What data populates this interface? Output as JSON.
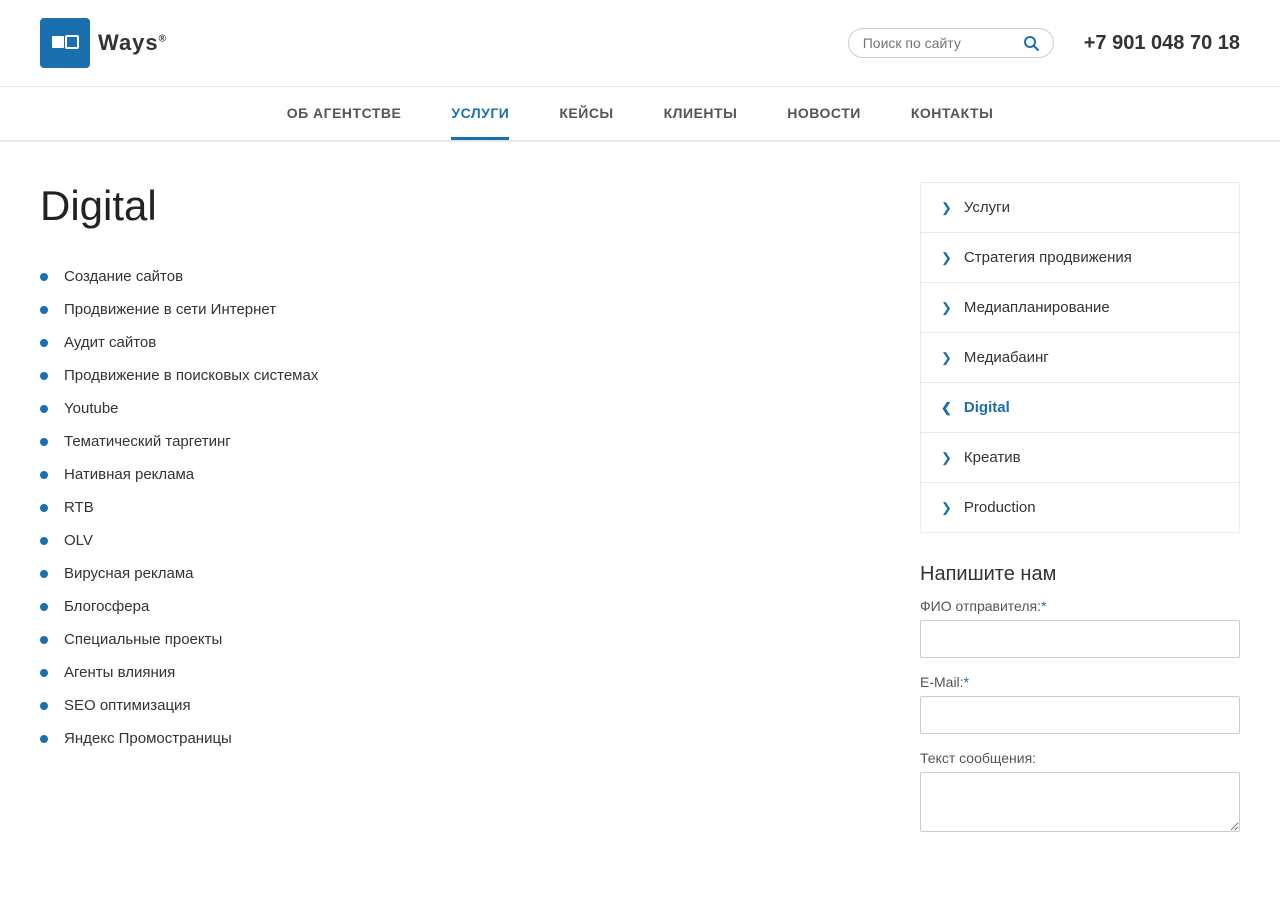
{
  "logo": {
    "text": "Ways",
    "sup": "®"
  },
  "header": {
    "search_placeholder": "Поиск по сайту",
    "phone": "+7 901 048 70 18"
  },
  "nav": {
    "items": [
      {
        "label": "ОБ АГЕНТСТВЕ",
        "active": false
      },
      {
        "label": "УСЛУГИ",
        "active": true
      },
      {
        "label": "КЕЙСЫ",
        "active": false
      },
      {
        "label": "КЛИЕНТЫ",
        "active": false
      },
      {
        "label": "НОВОСТИ",
        "active": false
      },
      {
        "label": "КОНТАКТЫ",
        "active": false
      }
    ]
  },
  "page": {
    "title": "Digital"
  },
  "items": [
    "Создание сайтов",
    "Продвижение в сети Интернет",
    "Аудит сайтов",
    "Продвижение в поисковых системах",
    "Youtube",
    "Тематический таргетинг",
    "Нативная реклама",
    "RTB",
    "OLV",
    "Вирусная реклама",
    "Блогосфера",
    "Специальные проекты",
    "Агенты влияния",
    "SEO оптимизация",
    "Яндекс Промостраницы"
  ],
  "sidebar": {
    "nav_items": [
      {
        "label": "Услуги",
        "active": false,
        "chevron": "right"
      },
      {
        "label": "Стратегия продвижения",
        "active": false,
        "chevron": "right"
      },
      {
        "label": "Медиапланирование",
        "active": false,
        "chevron": "right"
      },
      {
        "label": "Медиабаинг",
        "active": false,
        "chevron": "right"
      },
      {
        "label": "Digital",
        "active": true,
        "chevron": "left"
      },
      {
        "label": "Креатив",
        "active": false,
        "chevron": "right"
      },
      {
        "label": "Production",
        "active": false,
        "chevron": "right"
      }
    ]
  },
  "contact_form": {
    "title": "Напишите нам",
    "name_label": "ФИО отправителя:",
    "name_required": "*",
    "email_label": "E-Mail:",
    "email_required": "*",
    "message_label": "Текст сообщения:"
  }
}
